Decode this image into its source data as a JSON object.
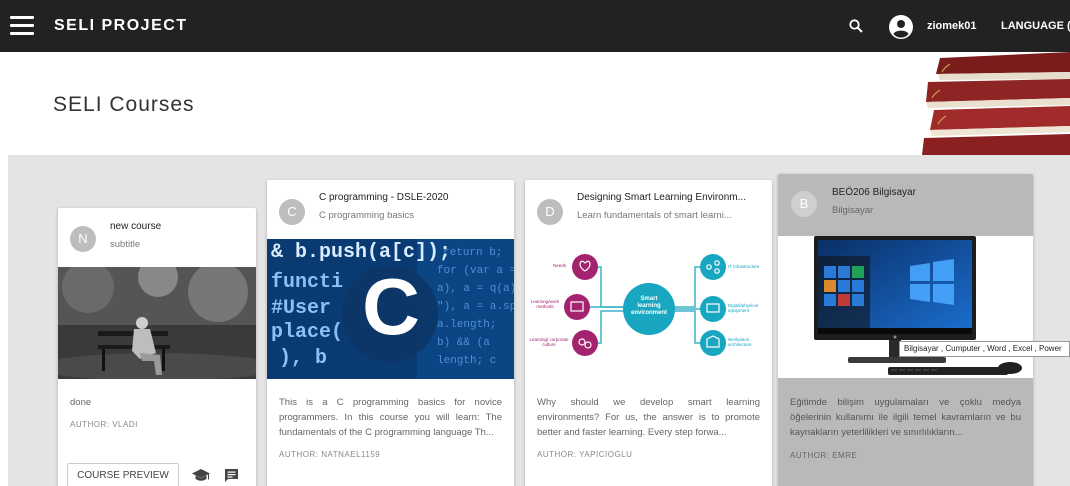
{
  "topbar": {
    "app_title": "SELI PROJECT",
    "username": "ziomek01",
    "language_label": "LANGUAGE (US"
  },
  "hero": {
    "title": "SELI Courses"
  },
  "courses": [
    {
      "avatar_letter": "N",
      "title": "new course",
      "subtitle": "subtitle",
      "description": "done",
      "author": "AUTHOR: VLADI",
      "preview_label": "COURSE PREVIEW"
    },
    {
      "avatar_letter": "C",
      "title": "C programming - DSLE-2020",
      "subtitle": "C programming basics",
      "description": "This is a C programming basics for novice programmers. In this course you will learn: The fundamentals of the C programming language Th...",
      "author": "AUTHOR: NATNAEL1159",
      "image_code_lines": [
        "& b.push(a[c]);",
        "functi",
        "#User",
        "place(",
        "), b"
      ],
      "image_letter": "C"
    },
    {
      "avatar_letter": "D",
      "title": "Designing Smart Learning Environm...",
      "subtitle": "Learn fundamentals of smart learni...",
      "description": "Why should we develop smart learning environments? For us, the answer is to promote better and faster learning. Every step forwa...",
      "author": "AUTHOR: YAPICIOGLU",
      "diagram": {
        "center": [
          "Smart",
          "learning",
          "environment"
        ],
        "left": [
          "Needs",
          "Learning/work methods",
          "Learning/ corporate culture"
        ],
        "right": [
          "IT infrastructure",
          "Digital/physical equipment",
          "Workplace architecture"
        ]
      }
    },
    {
      "avatar_letter": "B",
      "title": "BEÖ206 Bilgisayar",
      "subtitle": "Bilgisayar",
      "description": "Eğitimde bilişim uygulamaları ve çoklu medya öğelerinin kullanımı ile ilgili temel kavramların ve bu kaynakların yeterlilikleri ve sınırlılıkların...",
      "author": "AUTHOR: EMRE",
      "tooltip": "Bilgisayar , Cumputer , Word , Excel , Power"
    }
  ],
  "colors": {
    "topbar_bg": "#222222",
    "gallery_bg": "#e4e4e4",
    "selected_card_bg": "#b9b9b9"
  },
  "icons": [
    "menu-icon",
    "search-icon",
    "account-circle-icon",
    "graduation-cap-icon",
    "chat-icon",
    "windows-logo-icon"
  ]
}
